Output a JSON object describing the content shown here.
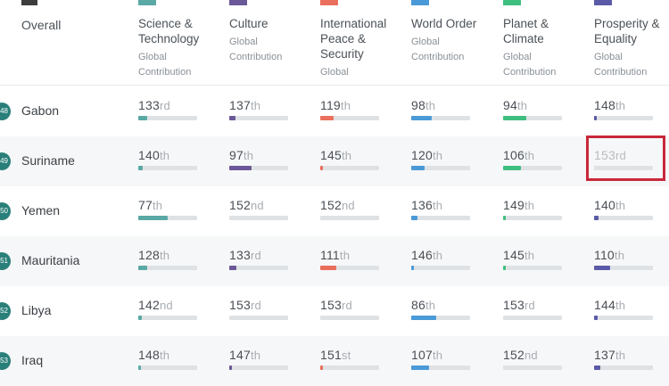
{
  "header": {
    "overall_label": "Overall",
    "columns": [
      {
        "name": "Science & Technology",
        "sub": "Global Contribution",
        "color": "#5aa9a5"
      },
      {
        "name": "Culture",
        "sub": "Global Contribution",
        "color": "#6a5898"
      },
      {
        "name": "International Peace & Security",
        "sub": "Global",
        "color": "#ea6f5c"
      },
      {
        "name": "World Order",
        "sub": "Global Contribution",
        "color": "#4a9ad8"
      },
      {
        "name": "Planet & Climate",
        "sub": "Global Contribution",
        "color": "#3fbf7f"
      },
      {
        "name": "Prosperity & Equality",
        "sub": "Global Contribution",
        "color": "#5a5aa8"
      }
    ]
  },
  "rows": [
    {
      "rank": "48",
      "country": "Gabon",
      "cells": [
        {
          "num": "133",
          "suf": "rd",
          "fill": 0.15
        },
        {
          "num": "137",
          "suf": "th",
          "fill": 0.1
        },
        {
          "num": "119",
          "suf": "th",
          "fill": 0.22
        },
        {
          "num": "98",
          "suf": "th",
          "fill": 0.35
        },
        {
          "num": "94",
          "suf": "th",
          "fill": 0.4
        },
        {
          "num": "148",
          "suf": "th",
          "fill": 0.04
        }
      ]
    },
    {
      "rank": "49",
      "country": "Suriname",
      "cells": [
        {
          "num": "140",
          "suf": "th",
          "fill": 0.08
        },
        {
          "num": "97",
          "suf": "th",
          "fill": 0.38
        },
        {
          "num": "145",
          "suf": "th",
          "fill": 0.05
        },
        {
          "num": "120",
          "suf": "th",
          "fill": 0.22
        },
        {
          "num": "106",
          "suf": "th",
          "fill": 0.3
        },
        {
          "num": "153",
          "suf": "rd",
          "fill": 0.0
        }
      ]
    },
    {
      "rank": "50",
      "country": "Yemen",
      "cells": [
        {
          "num": "77",
          "suf": "th",
          "fill": 0.5
        },
        {
          "num": "152",
          "suf": "nd",
          "fill": 0.0
        },
        {
          "num": "152",
          "suf": "nd",
          "fill": 0.0
        },
        {
          "num": "136",
          "suf": "th",
          "fill": 0.1
        },
        {
          "num": "149",
          "suf": "th",
          "fill": 0.03
        },
        {
          "num": "140",
          "suf": "th",
          "fill": 0.08
        }
      ]
    },
    {
      "rank": "51",
      "country": "Mauritania",
      "cells": [
        {
          "num": "128",
          "suf": "th",
          "fill": 0.15
        },
        {
          "num": "133",
          "suf": "rd",
          "fill": 0.12
        },
        {
          "num": "111",
          "suf": "th",
          "fill": 0.27
        },
        {
          "num": "146",
          "suf": "th",
          "fill": 0.05
        },
        {
          "num": "145",
          "suf": "th",
          "fill": 0.05
        },
        {
          "num": "110",
          "suf": "th",
          "fill": 0.27
        }
      ]
    },
    {
      "rank": "52",
      "country": "Libya",
      "cells": [
        {
          "num": "142",
          "suf": "nd",
          "fill": 0.06
        },
        {
          "num": "153",
          "suf": "rd",
          "fill": 0.0
        },
        {
          "num": "153",
          "suf": "rd",
          "fill": 0.0
        },
        {
          "num": "86",
          "suf": "th",
          "fill": 0.42
        },
        {
          "num": "153",
          "suf": "rd",
          "fill": 0.0
        },
        {
          "num": "144",
          "suf": "th",
          "fill": 0.06
        }
      ]
    },
    {
      "rank": "53",
      "country": "Iraq",
      "cells": [
        {
          "num": "148",
          "suf": "th",
          "fill": 0.03
        },
        {
          "num": "147",
          "suf": "th",
          "fill": 0.04
        },
        {
          "num": "151",
          "suf": "st",
          "fill": 0.01
        },
        {
          "num": "107",
          "suf": "th",
          "fill": 0.3
        },
        {
          "num": "152",
          "suf": "nd",
          "fill": 0.0
        },
        {
          "num": "137",
          "suf": "th",
          "fill": 0.1
        }
      ]
    }
  ],
  "highlight_color": "#c8283a"
}
